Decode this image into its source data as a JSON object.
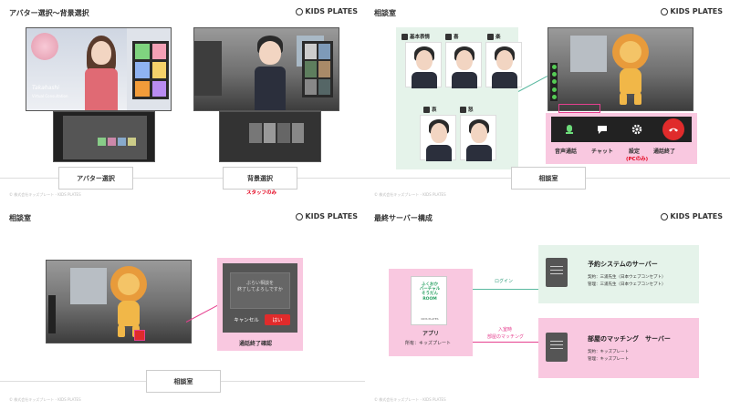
{
  "logo": "KIDS PLATES",
  "footer": "© 株式会社キッズプレート - KIDS PLATES",
  "panel1": {
    "title": "アバター選択〜背景選択",
    "step1": "アバター選択",
    "step2": "背景選択",
    "staff_only": "スタッフのみ",
    "screenshot_name": "Takahashi",
    "screenshot_sub": "Virtual Consultation"
  },
  "panel2": {
    "title": "相談室",
    "expressions": [
      "基本表情",
      "喜",
      "楽",
      "哀",
      "怒"
    ],
    "controls": [
      "音声通話",
      "チャット",
      "設定",
      "通話終了"
    ],
    "pc_only": "(PCのみ)",
    "step": "相談室"
  },
  "panel3": {
    "title": "相談室",
    "dialog_text": "ぶらい相談を\n終了してよろしですか",
    "dialog_cancel": "キャンセル",
    "dialog_ok": "はい",
    "confirm_label": "通話終了確認",
    "step": "相談室"
  },
  "panel4": {
    "title": "最終サーバー構成",
    "app_label": "アプリ",
    "app_owner": "所有：キッズプレート",
    "app_card_text": "ふくおか\nバーチャル\nそうだん\nROOM",
    "app_card_sub": "KIDS PLATES",
    "login_label": "ログイン",
    "matching_label_1": "入室時",
    "matching_label_2": "部屋のマッチング",
    "server1_title": "予約システムのサーバー",
    "server1_line1": "契約：三浦先生（日本ウェブコンセプト）",
    "server1_line2": "管理：三浦先生（日本ウェブコンセプト）",
    "server2_title": "部屋のマッチング　サーバー",
    "server2_line1": "契約：キッズプレート",
    "server2_line2": "管理：キッズプレート"
  },
  "colors": {
    "pink": "#f9c8e0",
    "mint": "#e5f3ea",
    "red": "#e3001b",
    "connector": "#5ab9a0",
    "pink_line": "#e6408f"
  }
}
